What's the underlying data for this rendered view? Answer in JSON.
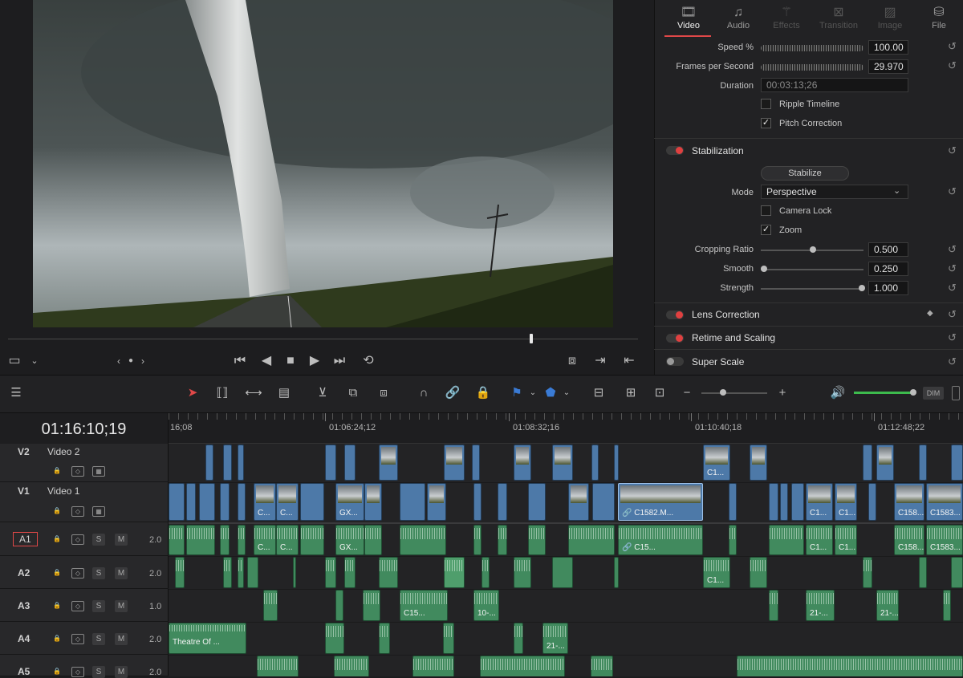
{
  "viewer": {
    "description_icons": [
      "viewer-size-icon",
      "chevron-down-icon",
      "prev-marker-icon",
      "dot-icon",
      "next-marker-icon"
    ],
    "transport": [
      "skip-start-icon",
      "play-reverse-icon",
      "stop-icon",
      "play-icon",
      "skip-end-icon",
      "loop-icon"
    ],
    "playhead_progress": 0.83
  },
  "inspector": {
    "tabs": [
      {
        "label": "Video",
        "icon": "film-icon",
        "active": true
      },
      {
        "label": "Audio",
        "icon": "music-icon",
        "active": false
      },
      {
        "label": "Effects",
        "icon": "wand-icon",
        "active": false
      },
      {
        "label": "Transition",
        "icon": "transition-icon",
        "active": false
      },
      {
        "label": "Image",
        "icon": "image-icon",
        "active": false
      },
      {
        "label": "File",
        "icon": "file-icon",
        "active": false
      }
    ],
    "speed": {
      "label": "Speed %",
      "value": "100.00"
    },
    "fps": {
      "label": "Frames per Second",
      "value": "29.970"
    },
    "duration": {
      "label": "Duration",
      "value": "00:03:13;26"
    },
    "ripple": {
      "label": "Ripple Timeline",
      "checked": false
    },
    "pitch": {
      "label": "Pitch Correction",
      "checked": true
    },
    "stabilization": {
      "title": "Stabilization",
      "button": "Stabilize",
      "mode_label": "Mode",
      "mode_value": "Perspective",
      "camera_lock": {
        "label": "Camera Lock",
        "checked": false
      },
      "zoom": {
        "label": "Zoom",
        "checked": true
      },
      "cropping": {
        "label": "Cropping Ratio",
        "value": "0.500",
        "level": 0.5
      },
      "smooth": {
        "label": "Smooth",
        "value": "0.250",
        "level": 0.0
      },
      "strength": {
        "label": "Strength",
        "value": "1.000",
        "level": 1.0
      }
    },
    "sections": [
      {
        "title": "Lens Correction",
        "enabled": true
      },
      {
        "title": "Retime and Scaling",
        "enabled": true
      },
      {
        "title": "Super Scale",
        "enabled": false
      }
    ]
  },
  "toolbar": {
    "dim_label": "DIM",
    "zoom_minus": "−",
    "zoom_plus": "+",
    "volume_level": 1.0
  },
  "timeline": {
    "timecode": "01:16:10;19",
    "ruler": [
      "16;08",
      "01:06:24;12",
      "01:08:32;16",
      "01:10:40;18",
      "01:12:48;22"
    ],
    "tracks": [
      {
        "id": "V2",
        "name": "Video 2"
      },
      {
        "id": "V1",
        "name": "Video 1"
      },
      {
        "id": "A1",
        "level": "2.0",
        "solo": "S",
        "mute": "M"
      },
      {
        "id": "A2",
        "level": "2.0",
        "solo": "S",
        "mute": "M"
      },
      {
        "id": "A3",
        "level": "1.0",
        "solo": "S",
        "mute": "M"
      },
      {
        "id": "A4",
        "level": "2.0",
        "solo": "S",
        "mute": "M"
      },
      {
        "id": "A5",
        "level": "2.0",
        "solo": "S",
        "mute": "M"
      }
    ],
    "clip_labels": {
      "v2a": "C1...",
      "v1a": "C...",
      "v1b": "C...",
      "v1c": "GX...",
      "v1d": "C1582.M...",
      "v1e": "C1...",
      "v1f": "C1...",
      "v1g": "C158...",
      "v1h": "C1583...",
      "a1a": "C...",
      "a1b": "C...",
      "a1c": "GX...",
      "a1d": "C15...",
      "a1e": "C1...",
      "a1f": "C1...",
      "a1g": "C158...",
      "a1h": "C1583...",
      "a2a": "C1...",
      "a3a": "C15...",
      "a3b": "10-...",
      "a3c": "21-...",
      "a3d": "21-...",
      "a4a": "Theatre Of ...",
      "a4b": "21-..."
    }
  }
}
